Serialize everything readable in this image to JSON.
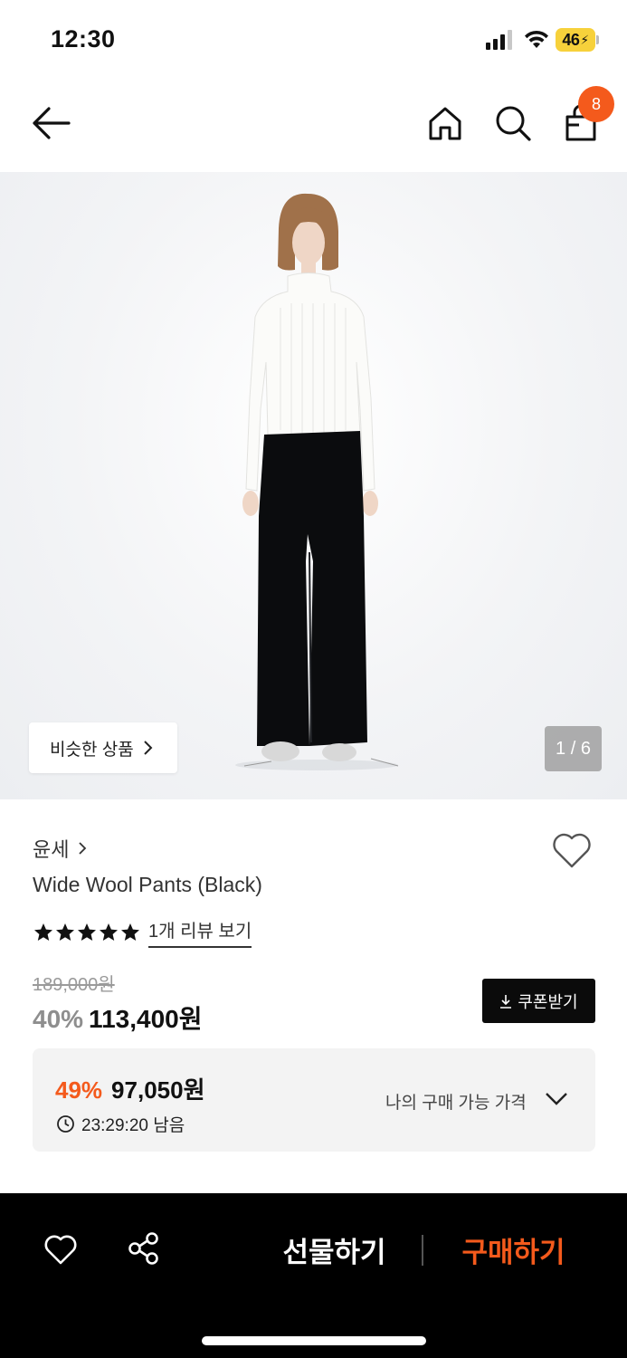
{
  "status_bar": {
    "time": "12:30",
    "battery_label": "46",
    "icons": [
      "signal-icon",
      "wifi-icon",
      "battery-icon"
    ]
  },
  "nav": {
    "icons": [
      "back-arrow-icon",
      "home-icon",
      "search-icon",
      "shopping-bag-icon"
    ],
    "cart_count": "8"
  },
  "gallery": {
    "similar_label": "비슷한 상품",
    "counter": "1 / 6"
  },
  "product": {
    "brand": "윤세",
    "title": "Wide Wool Pants (Black)",
    "stars": 5,
    "review_link": "1개 리뷰 보기",
    "original_price": "189,000원",
    "discount": "40%",
    "price": "113,400원",
    "coupon_label": "쿠폰받기"
  },
  "best_price": {
    "discount": "49%",
    "price": "97,050원",
    "timer": "23:29:20 남음",
    "label": "나의 구매 가능 가격"
  },
  "bottom_bar": {
    "gift_label": "선물하기",
    "buy_label": "구매하기"
  },
  "colors": {
    "accent": "#f45a1c",
    "black": "#000000",
    "box_bg": "#f3f3f3"
  }
}
